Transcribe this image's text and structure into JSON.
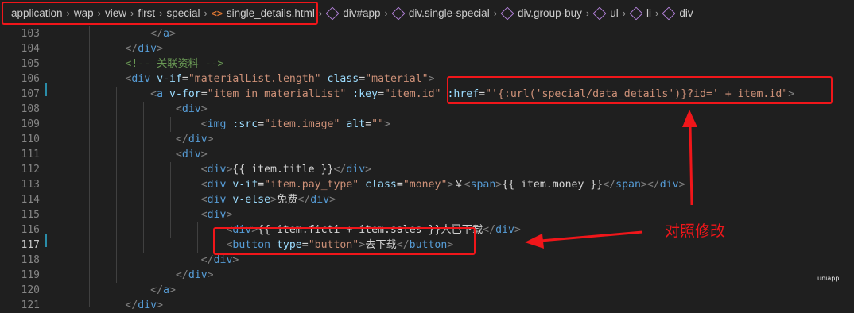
{
  "breadcrumb": {
    "items": [
      "application",
      "wap",
      "view",
      "first",
      "special",
      "single_details.html",
      "div#app",
      "div.single-special",
      "div.group-buy",
      "ul",
      "li",
      "div"
    ]
  },
  "editor": {
    "line_numbers": [
      "103",
      "104",
      "105",
      "106",
      "107",
      "108",
      "109",
      "110",
      "111",
      "112",
      "113",
      "114",
      "115",
      "116",
      "117",
      "118",
      "119",
      "120",
      "121"
    ],
    "active_line": "117"
  },
  "annotation": {
    "text": "对照修改"
  },
  "watermark": {
    "text": "uniapp"
  },
  "colors": {
    "annotation_red": "#f0161a",
    "tag": "#569cd6",
    "attribute": "#9cdcfe",
    "string": "#ce9178",
    "comment": "#6a9955"
  }
}
